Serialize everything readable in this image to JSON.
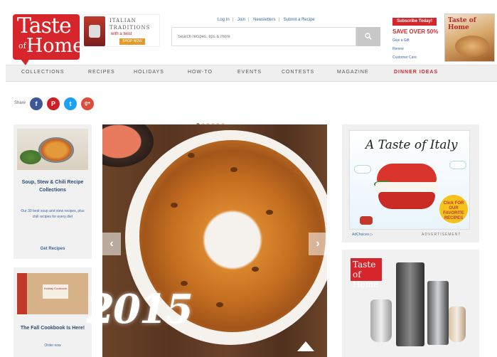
{
  "header": {
    "logo_line1": "Taste",
    "logo_line2_small": "of",
    "logo_line2": "Home",
    "promo": {
      "line1": "ITALIAN",
      "line2": "TRADITIONS",
      "line3": "with a twist",
      "button": "SHOP NOW"
    },
    "top_links": [
      "Log In",
      "Join",
      "Newsletters",
      "Submit a Recipe"
    ],
    "search": {
      "placeholder": "Search recipes, tips & more",
      "button_icon": "search-icon"
    },
    "subscribe": {
      "badge": "Subscribe Today!",
      "headline": "SAVE OVER 50%",
      "line1": "Give a Gift",
      "line2": "Renew",
      "line3": "Customer Care"
    },
    "magazine_title": "Taste of Home"
  },
  "nav": {
    "items": [
      "COLLECTIONS",
      "RECIPES",
      "HOLIDAYS",
      "HOW-TO",
      "EVENTS",
      "CONTESTS",
      "MAGAZINE",
      "DINNER IDEAS"
    ],
    "highlight_color": "#d7262b"
  },
  "share": {
    "label": "Share",
    "icons": [
      {
        "name": "facebook-icon",
        "glyph": "f",
        "color": "#3b5998"
      },
      {
        "name": "pinterest-icon",
        "glyph": "P",
        "color": "#cb2027"
      },
      {
        "name": "twitter-icon",
        "glyph": "t",
        "color": "#1da1f2"
      },
      {
        "name": "google-plus-icon",
        "glyph": "g+",
        "color": "#dd4b39"
      }
    ]
  },
  "carousel": {
    "dots": 6,
    "active_dot": 1,
    "prev_icon": "chevron-left-icon",
    "next_icon": "chevron-right-icon",
    "overlay_year": "2015"
  },
  "left_cards": [
    {
      "title": "Soup, Stew & Chili Recipe Collections",
      "text": "Our 30 best soup and stew recipes, plus chili recipes for every diet",
      "link": "Get Recipes"
    },
    {
      "title": "The Fall Cookbook Is Here!",
      "gift_label": "Holiday Cookbook",
      "text": "Order now"
    }
  ],
  "right_ads": {
    "italy": {
      "title": "A Taste of Italy",
      "badge": "Click FOR OUR FAVORITE RECIPES",
      "choices": "AdChoices ▷",
      "label": "ADVERTISEMENT"
    },
    "appliance_logo": "Taste of Home"
  }
}
